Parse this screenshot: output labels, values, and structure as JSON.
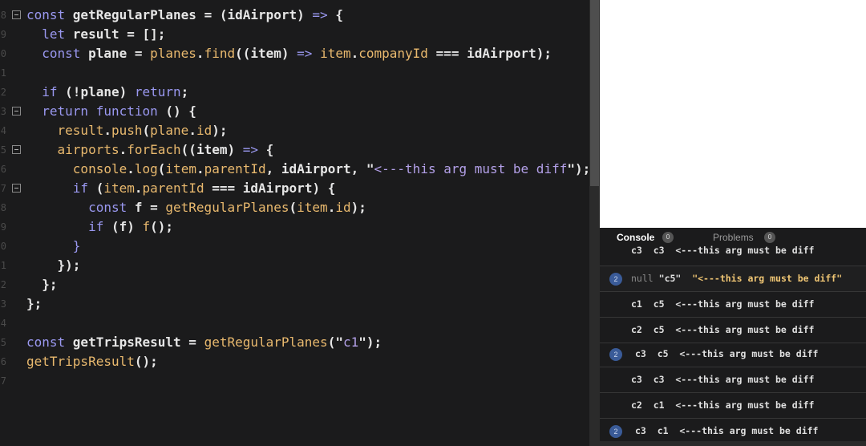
{
  "editor": {
    "lines": [
      {
        "n": "8",
        "fold": true,
        "tokens": [
          [
            "kw",
            "const "
          ],
          [
            "pl",
            "getRegularPlanes "
          ],
          [
            "pl",
            "= "
          ],
          [
            "pl",
            "(idAirport) "
          ],
          [
            "kw",
            "=> "
          ],
          [
            "pl",
            "{"
          ]
        ]
      },
      {
        "n": "9",
        "fold": false,
        "tokens": [
          [
            "pl",
            "  "
          ],
          [
            "kw",
            "let "
          ],
          [
            "pl",
            "result = [];"
          ]
        ]
      },
      {
        "n": "0",
        "fold": false,
        "tokens": [
          [
            "pl",
            "  "
          ],
          [
            "kw",
            "const "
          ],
          [
            "pl",
            "plane = "
          ],
          [
            "fn",
            "planes"
          ],
          [
            "pl",
            "."
          ],
          [
            "fn",
            "find"
          ],
          [
            "pl",
            "((item) "
          ],
          [
            "kw",
            "=> "
          ],
          [
            "fn",
            "item"
          ],
          [
            "pl",
            "."
          ],
          [
            "fn",
            "companyId "
          ],
          [
            "pl",
            "=== idAirport);"
          ]
        ]
      },
      {
        "n": "1",
        "fold": false,
        "tokens": []
      },
      {
        "n": "2",
        "fold": false,
        "tokens": [
          [
            "pl",
            "  "
          ],
          [
            "kw",
            "if "
          ],
          [
            "pl",
            "(!plane) "
          ],
          [
            "kw",
            "return"
          ],
          [
            "pl",
            ";"
          ]
        ]
      },
      {
        "n": "3",
        "fold": true,
        "tokens": [
          [
            "pl",
            "  "
          ],
          [
            "kw",
            "return function "
          ],
          [
            "pl",
            "() {"
          ]
        ]
      },
      {
        "n": "4",
        "fold": false,
        "tokens": [
          [
            "pl",
            "    "
          ],
          [
            "fn",
            "result"
          ],
          [
            "pl",
            "."
          ],
          [
            "fn",
            "push"
          ],
          [
            "pl",
            "("
          ],
          [
            "fn",
            "plane"
          ],
          [
            "pl",
            "."
          ],
          [
            "fn",
            "id"
          ],
          [
            "pl",
            ");"
          ]
        ]
      },
      {
        "n": "5",
        "fold": true,
        "tokens": [
          [
            "pl",
            "    "
          ],
          [
            "fn",
            "airports"
          ],
          [
            "pl",
            "."
          ],
          [
            "fn",
            "forEach"
          ],
          [
            "pl",
            "((item) "
          ],
          [
            "kw",
            "=> "
          ],
          [
            "pl",
            "{"
          ]
        ]
      },
      {
        "n": "6",
        "fold": false,
        "tokens": [
          [
            "pl",
            "      "
          ],
          [
            "fn",
            "console"
          ],
          [
            "pl",
            "."
          ],
          [
            "fn",
            "log"
          ],
          [
            "pl",
            "("
          ],
          [
            "fn",
            "item"
          ],
          [
            "pl",
            "."
          ],
          [
            "fn",
            "parentId"
          ],
          [
            "pl",
            ", idAirport, \""
          ],
          [
            "str",
            "<---this arg must be diff"
          ],
          [
            "pl",
            "\");"
          ]
        ]
      },
      {
        "n": "7",
        "fold": true,
        "tokens": [
          [
            "pl",
            "      "
          ],
          [
            "kw",
            "if "
          ],
          [
            "pl",
            "("
          ],
          [
            "fn",
            "item"
          ],
          [
            "pl",
            "."
          ],
          [
            "fn",
            "parentId "
          ],
          [
            "pl",
            "=== idAirport) {"
          ]
        ]
      },
      {
        "n": "8",
        "fold": false,
        "tokens": [
          [
            "pl",
            "        "
          ],
          [
            "kw",
            "const "
          ],
          [
            "pl",
            "f = "
          ],
          [
            "fn",
            "getRegularPlanes"
          ],
          [
            "pl",
            "("
          ],
          [
            "fn",
            "item"
          ],
          [
            "pl",
            "."
          ],
          [
            "fn",
            "id"
          ],
          [
            "pl",
            ");"
          ]
        ]
      },
      {
        "n": "9",
        "fold": false,
        "tokens": [
          [
            "pl",
            "        "
          ],
          [
            "kw",
            "if "
          ],
          [
            "pl",
            "(f) "
          ],
          [
            "fn",
            "f"
          ],
          [
            "pl",
            "();"
          ]
        ]
      },
      {
        "n": "0",
        "fold": false,
        "tokens": [
          [
            "pl",
            "      "
          ],
          [
            "kw",
            "}"
          ]
        ]
      },
      {
        "n": "1",
        "fold": false,
        "tokens": [
          [
            "pl",
            "    });"
          ]
        ]
      },
      {
        "n": "2",
        "fold": false,
        "tokens": [
          [
            "pl",
            "  };"
          ]
        ]
      },
      {
        "n": "3",
        "fold": false,
        "tokens": [
          [
            "pl",
            "};"
          ]
        ]
      },
      {
        "n": "4",
        "fold": false,
        "tokens": []
      },
      {
        "n": "5",
        "fold": false,
        "tokens": [
          [
            "kw",
            "const "
          ],
          [
            "pl",
            "getTripsResult = "
          ],
          [
            "fn",
            "getRegularPlanes"
          ],
          [
            "pl",
            "(\""
          ],
          [
            "str",
            "c1"
          ],
          [
            "pl",
            "\");"
          ]
        ]
      },
      {
        "n": "6",
        "fold": false,
        "tokens": [
          [
            "fn",
            "getTripsResult"
          ],
          [
            "pl",
            "();"
          ]
        ]
      },
      {
        "n": "7",
        "fold": false,
        "tokens": []
      }
    ]
  },
  "panel": {
    "tabs": {
      "console_label": "Console",
      "console_count": "0",
      "problems_label": "Problems",
      "problems_count": "0"
    },
    "logs": [
      {
        "count": "",
        "text": "c3  c3  <---this arg must be diff",
        "partial": true
      },
      {
        "count": "2",
        "warn": true,
        "null": "null",
        "a": "\"c5\"",
        "b": "\"<---this arg must be diff\""
      },
      {
        "count": "",
        "text": "c1  c5  <---this arg must be diff"
      },
      {
        "count": "",
        "text": "c2  c5  <---this arg must be diff"
      },
      {
        "count": "2",
        "text": "c3  c5  <---this arg must be diff"
      },
      {
        "count": "",
        "text": "c3  c3  <---this arg must be diff"
      },
      {
        "count": "",
        "text": "c2  c1  <---this arg must be diff"
      },
      {
        "count": "2",
        "text": "c3  c1  <---this arg must be diff"
      }
    ]
  }
}
